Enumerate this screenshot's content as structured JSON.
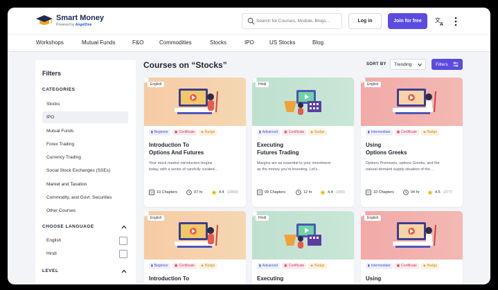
{
  "brand": {
    "name": "Smart Money",
    "sub_prefix": "Powered by",
    "sub_brand": "AngelOne"
  },
  "search": {
    "placeholder": "Search for Courses, Module, Blogs..."
  },
  "header": {
    "login_label": "Log in",
    "join_label": "Join for free"
  },
  "nav": [
    "Workshops",
    "Mutual Funds",
    "F&O",
    "Commodities",
    "Stocks",
    "IPO",
    "US Stocks",
    "Blog"
  ],
  "sidebar": {
    "title": "Filters",
    "categories_heading": "CATEGORIES",
    "categories": [
      "Stocks",
      "IPO",
      "Mutual Funds",
      "Forex Trading",
      "Currency Trading",
      "Social Stock Exchanges (SSEs)",
      "Market and Taxation",
      "Commodity, and Govt. Securities",
      "Other Courses"
    ],
    "active_category": "IPO",
    "language_heading": "CHOOSE LANGUAGE",
    "languages": [
      "English",
      "Hindi"
    ],
    "level_heading": "LEVEL"
  },
  "main": {
    "title": "Courses on “Stocks”",
    "sort_label": "SORT BY",
    "sort_value": "Trending",
    "filters_label": "Filters"
  },
  "cards": [
    {
      "lang": "English",
      "level": "Beginner",
      "cert": "Certificate",
      "badge": "Badge",
      "title_1": "Introduction To",
      "title_2": "Options And Futures",
      "desc_1": "Your stock market introduction begins",
      "desc_2": "today, with a series of carefully curated...",
      "chapters": "10 Chapters",
      "hours": "07 hr",
      "rating": "4.4",
      "reviews": "(2868)"
    },
    {
      "lang": "Hindi",
      "level": "Advanced",
      "cert": "Certificate",
      "badge": "Badge",
      "title_1": "Executing",
      "title_2": "Futures Trading",
      "desc_1": "Margins are as essential to your investment",
      "desc_2": "as the money you're investing. Let's...",
      "chapters": "09 Chapters",
      "hours": "12 hr",
      "rating": "4.4",
      "reviews": "(266)"
    },
    {
      "lang": "English",
      "level": "Intermediate",
      "cert": "Certificate",
      "badge": "Badge",
      "title_1": "Using",
      "title_2": "Options Greeks",
      "desc_1": "Options Premiums, options Greeks, and the",
      "desc_2": "natural demand supply situation of the...",
      "chapters": "10 Chapters",
      "hours": "04 hr",
      "rating": "4.5",
      "reviews": "(377)"
    },
    {
      "lang": "English",
      "level": "Beginner",
      "cert": "Certificate",
      "badge": "Badge",
      "title_1": "Introduction To"
    },
    {
      "lang": "Hindi",
      "level": "Advanced",
      "cert": "Certificate",
      "badge": "Badge",
      "title_1": "Executing"
    },
    {
      "lang": "English",
      "level": "Intermediate",
      "cert": "Certificate",
      "badge": "Badge",
      "title_1": "Using"
    }
  ],
  "colors": {
    "accent": "#5b4be0",
    "thumb_peach": "#f6cba4",
    "thumb_green": "#bfe0cf",
    "thumb_pink": "#f1aaa8"
  }
}
